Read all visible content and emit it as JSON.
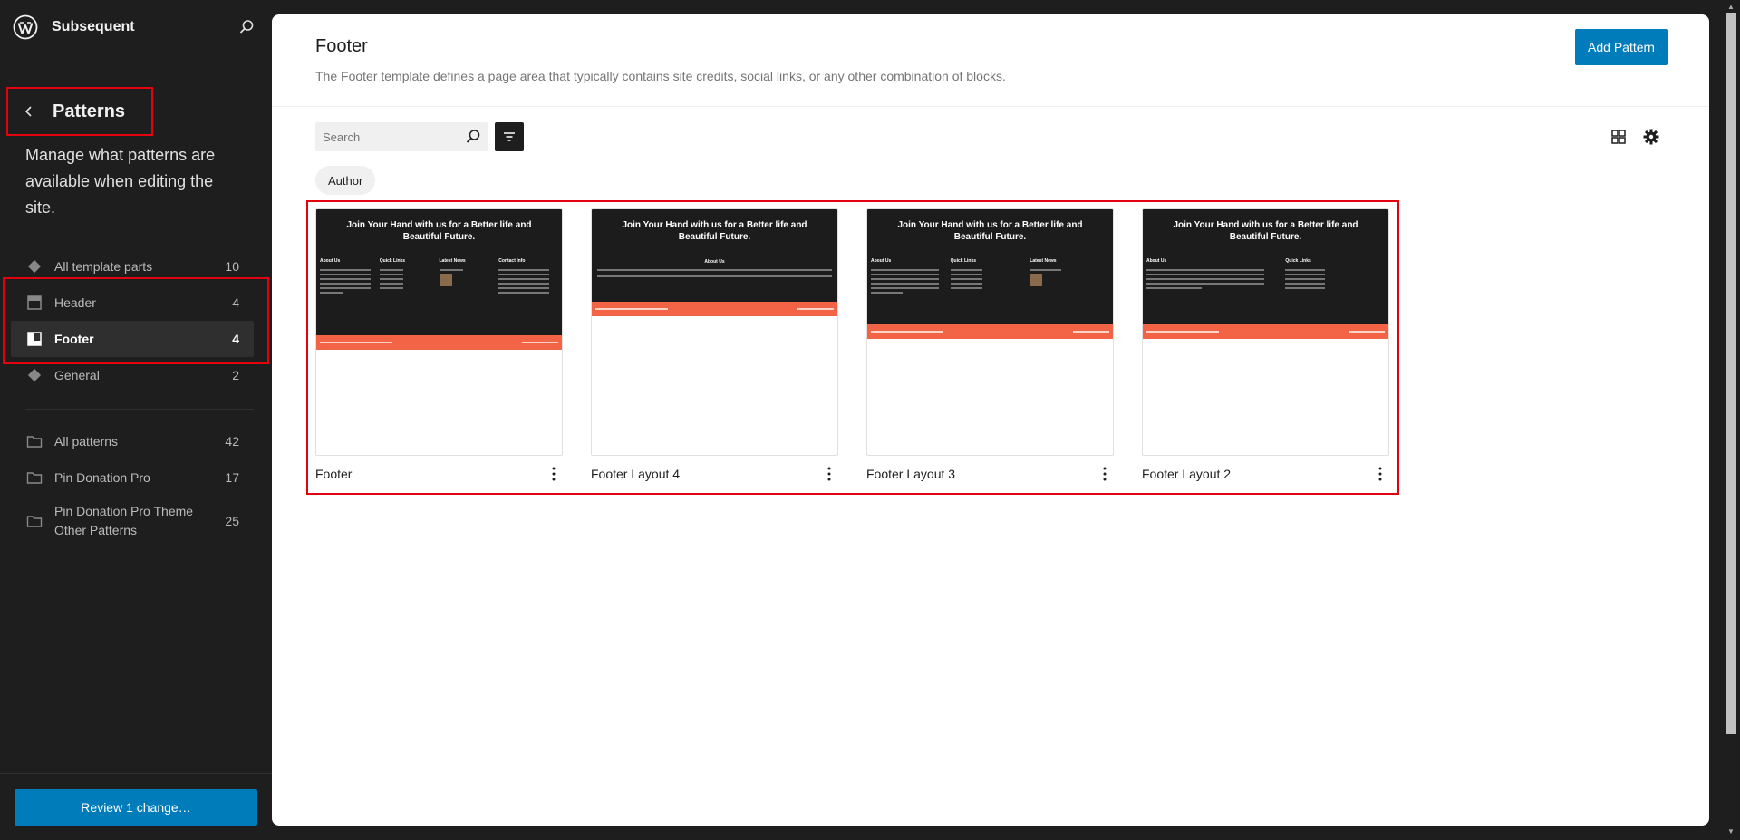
{
  "site": {
    "title": "Subsequent"
  },
  "sidebar": {
    "title": "Patterns",
    "description": "Manage what patterns are available when editing the site.",
    "template_parts": [
      {
        "label": "All template parts",
        "count": "10",
        "icon": "symbol-icon"
      },
      {
        "label": "Header",
        "count": "4",
        "icon": "header-icon"
      },
      {
        "label": "Footer",
        "count": "4",
        "icon": "footer-icon",
        "active": true
      },
      {
        "label": "General",
        "count": "2",
        "icon": "symbol-icon"
      }
    ],
    "categories": [
      {
        "label": "All patterns",
        "count": "42",
        "icon": "folder-icon"
      },
      {
        "label": "Pin Donation Pro",
        "count": "17",
        "icon": "folder-icon"
      },
      {
        "label": "Pin Donation Pro Theme Other Patterns",
        "count": "25",
        "icon": "folder-icon"
      }
    ],
    "review_button": "Review 1 change…"
  },
  "main": {
    "title": "Footer",
    "description": "The Footer template defines a page area that typically contains site credits, social links, or any other combination of blocks.",
    "add_button": "Add Pattern",
    "search": {
      "placeholder": "Search"
    },
    "filter_chip": "Author",
    "patterns": [
      {
        "name": "Footer",
        "headline": "Join Your Hand with us for a Better life and Beautiful Future.",
        "columns": [
          "About Us",
          "Quick Links",
          "Latest News",
          "Contact Info"
        ]
      },
      {
        "name": "Footer Layout 4",
        "headline": "Join Your Hand with us for a Better life and Beautiful Future.",
        "columns": [
          "About Us"
        ]
      },
      {
        "name": "Footer Layout 3",
        "headline": "Join Your Hand with us for a Better life and Beautiful Future.",
        "columns": [
          "About Us",
          "Quick Links",
          "Latest News"
        ]
      },
      {
        "name": "Footer Layout 2",
        "headline": "Join Your Hand with us for a Better life and Beautiful Future.",
        "columns": [
          "About Us",
          "Quick Links"
        ]
      }
    ]
  },
  "colors": {
    "accent": "#007cba",
    "highlight": "#e3000f",
    "sidebar_bg": "#1e1e1e",
    "footer_orange": "#f26445"
  }
}
